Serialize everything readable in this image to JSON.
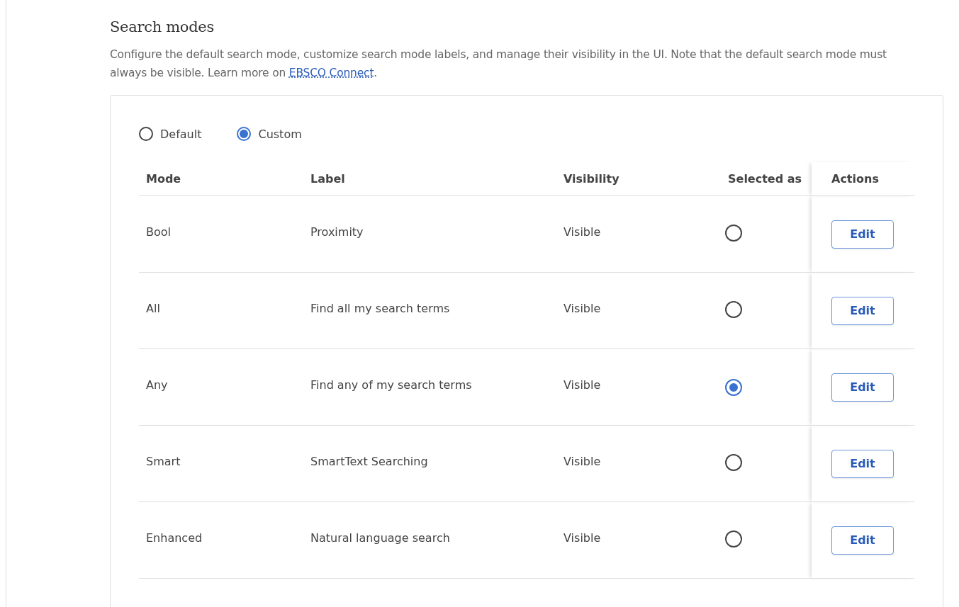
{
  "section": {
    "title": "Search modes",
    "description": "Configure the default search mode, customize search mode labels, and manage their visibility in the UI. Note that the default search mode must always be visible. Learn more on ",
    "link": "EBSCO Connect",
    "description_end": "."
  },
  "mode_options": [
    {
      "label": "Default",
      "selected": false
    },
    {
      "label": "Custom",
      "selected": true
    }
  ],
  "table": {
    "columns": [
      "Mode",
      "Label",
      "Visibility",
      "Selected as",
      "Actions"
    ],
    "rows": [
      {
        "mode": "Bool",
        "label": "Proximity",
        "visibility": "Visible",
        "selected": false,
        "action": "Edit"
      },
      {
        "mode": "All",
        "label": "Find all my search terms",
        "visibility": "Visible",
        "selected": false,
        "action": "Edit"
      },
      {
        "mode": "Any",
        "label": "Find any of my search terms",
        "visibility": "Visible",
        "selected": true,
        "action": "Edit"
      },
      {
        "mode": "Smart",
        "label": "SmartText Searching",
        "visibility": "Visible",
        "selected": false,
        "action": "Edit"
      },
      {
        "mode": "Enhanced",
        "label": "Natural language search",
        "visibility": "Visible",
        "selected": false,
        "action": "Edit"
      }
    ]
  }
}
